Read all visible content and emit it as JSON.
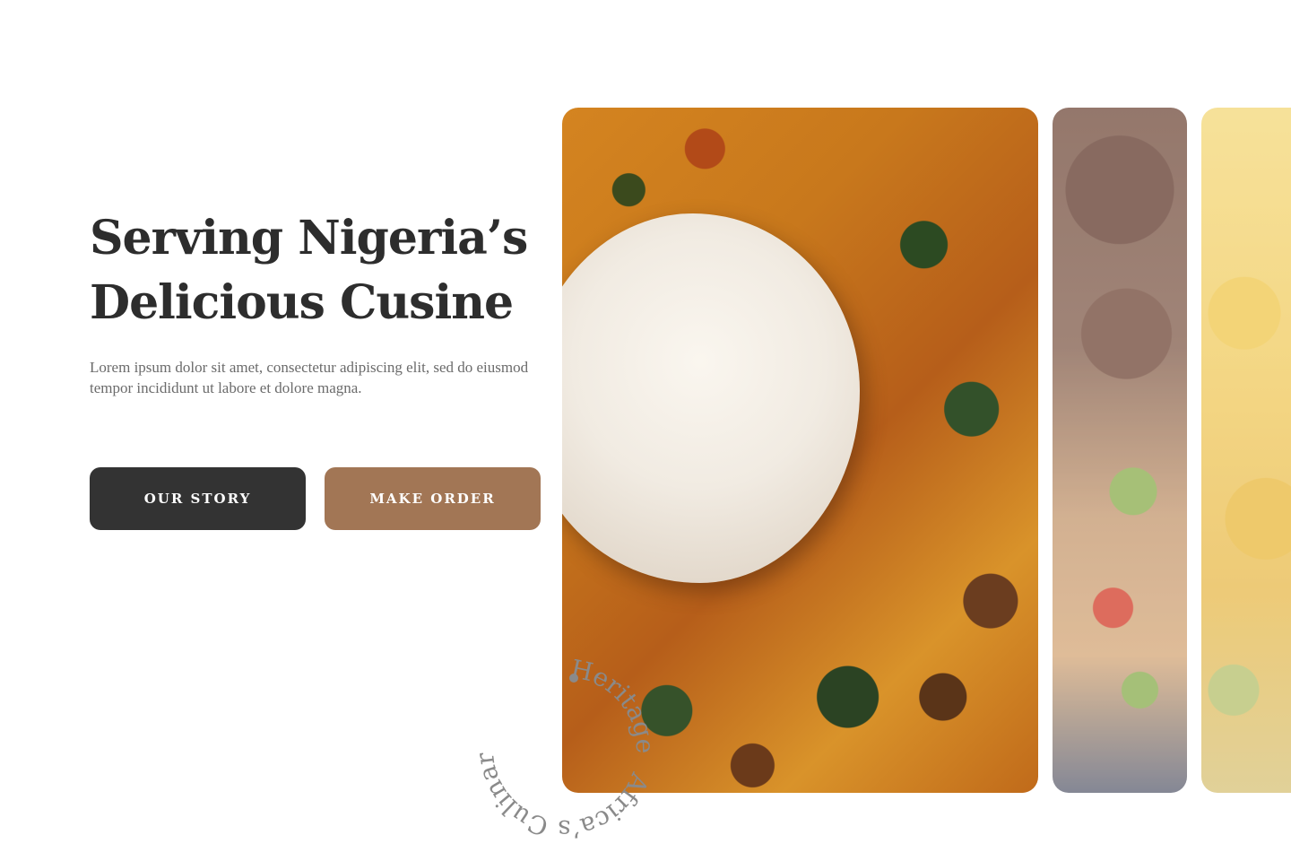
{
  "hero": {
    "title_line1": "Serving Nigeria’s",
    "title_line2": "Delicious Cusine",
    "description": "Lorem ipsum dolor sit amet, consectetur adipiscing elit, sed do eiusmod tempor incididunt ut labore et dolore magna."
  },
  "actions": {
    "our_story_label": "OUR STORY",
    "make_order_label": "MAKE ORDER"
  },
  "badge": {
    "text_left": "Heritage",
    "text_right": "Africa’s Culinary"
  },
  "colors": {
    "title": "#2d2d2d",
    "body_text": "#6b6b6b",
    "button_dark": "#333333",
    "button_brown": "#a27655",
    "badge_text": "#8a8a8a"
  },
  "gallery": {
    "items": [
      {
        "dish": "pounded-yam-egusi"
      },
      {
        "dish": "jollof-rice"
      },
      {
        "dish": "soup"
      }
    ]
  }
}
